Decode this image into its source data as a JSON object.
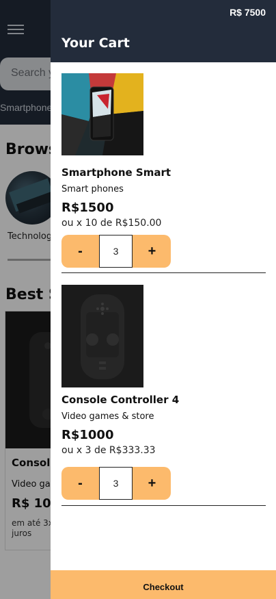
{
  "background": {
    "search_placeholder": "Search y",
    "category_link": "Smartphone",
    "browse_heading": "Brows",
    "category_label": "Technolog",
    "best_heading": "Best S",
    "product": {
      "title": "Console",
      "category": "Video ga",
      "price": "R$ 100",
      "installments": "em até 3x juros"
    }
  },
  "cart": {
    "total": "R$ 7500",
    "title": "Your Cart",
    "items": [
      {
        "name": "Smartphone Smart",
        "category": "Smart phones",
        "price": "R$1500",
        "installments": "ou x 10 de R$150.00",
        "quantity": "3",
        "image_icon": "smartphone-image"
      },
      {
        "name": "Console Controller 4",
        "category": "Video games & store",
        "price": "R$1000",
        "installments": "ou x 3 de R$333.33",
        "quantity": "3",
        "image_icon": "game-controller-image"
      }
    ],
    "minus_label": "-",
    "plus_label": "+",
    "checkout_label": "Checkout"
  },
  "colors": {
    "header": "#232c3b",
    "accent": "#fcba6c"
  }
}
